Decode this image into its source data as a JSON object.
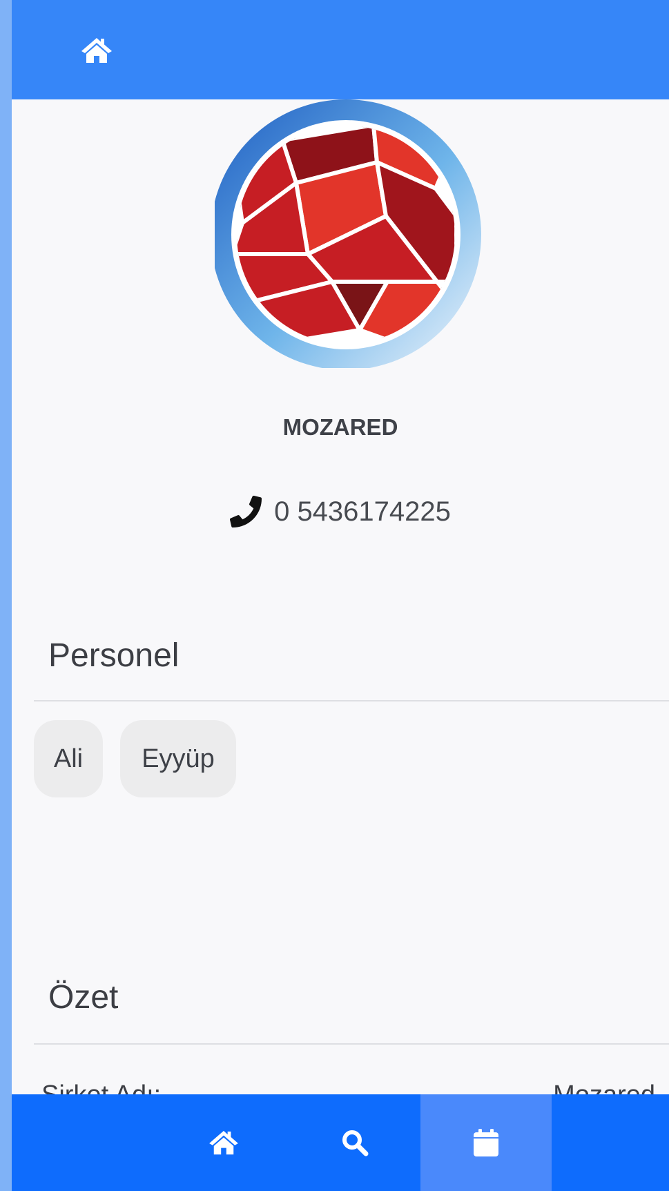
{
  "header": {
    "home_icon": "home-icon"
  },
  "company": {
    "name": "MOZARED",
    "phone": "0 5436174225",
    "phone_icon": "phone-icon"
  },
  "personnel": {
    "title": "Personel",
    "members": [
      "Ali",
      "Eyyüp"
    ]
  },
  "summary": {
    "title": "Özet",
    "rows": [
      {
        "label": "Şirket Adı:",
        "value": "Mozared"
      }
    ]
  },
  "bottom_nav": {
    "items": [
      {
        "icon": "home-icon",
        "active": false
      },
      {
        "icon": "search-icon",
        "active": false
      },
      {
        "icon": "calendar-icon",
        "active": true
      }
    ]
  },
  "colors": {
    "header": "#3686f8",
    "bottom_nav": "#0e6cfd",
    "bottom_nav_active": "#4a89fb",
    "logo_red": "#e2352a",
    "logo_dark_red": "#8e1219",
    "ring_blue": "#2f6fd0"
  }
}
